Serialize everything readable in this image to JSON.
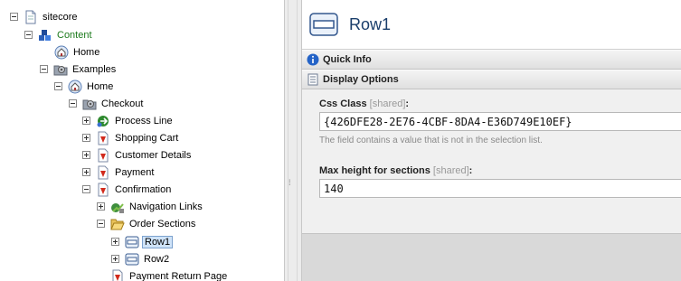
{
  "tree": {
    "items": [
      {
        "label": "sitecore",
        "toggle": "minus",
        "icon": "document-icon"
      },
      {
        "label": "Content",
        "toggle": "minus",
        "icon": "content-cubes-icon"
      },
      {
        "label": "Home",
        "toggle": "none",
        "icon": "home-icon"
      },
      {
        "label": "Examples",
        "toggle": "minus",
        "icon": "folder-gear-icon"
      },
      {
        "label": "Home",
        "toggle": "minus",
        "icon": "home-icon"
      },
      {
        "label": "Checkout",
        "toggle": "minus",
        "icon": "folder-gear-icon"
      },
      {
        "label": "Process Line",
        "toggle": "plus",
        "icon": "process-line-icon"
      },
      {
        "label": "Shopping Cart",
        "toggle": "plus",
        "icon": "page-red-icon"
      },
      {
        "label": "Customer Details",
        "toggle": "plus",
        "icon": "page-red-icon"
      },
      {
        "label": "Payment",
        "toggle": "plus",
        "icon": "page-red-icon"
      },
      {
        "label": "Confirmation",
        "toggle": "minus",
        "icon": "page-red-icon"
      },
      {
        "label": "Navigation Links",
        "toggle": "plus",
        "icon": "navigation-links-icon"
      },
      {
        "label": "Order Sections",
        "toggle": "minus",
        "icon": "folder-open-icon"
      },
      {
        "label": "Row1",
        "toggle": "plus",
        "icon": "row-icon"
      },
      {
        "label": "Row2",
        "toggle": "plus",
        "icon": "row-icon"
      },
      {
        "label": "Payment Return Page",
        "toggle": "none",
        "icon": "page-red-icon"
      }
    ]
  },
  "editor": {
    "title": "Row1",
    "sections": {
      "quick_info": "Quick Info",
      "display_options": "Display Options"
    },
    "fields": {
      "css_class": {
        "label": "Css Class",
        "shared": "[shared]",
        "colon": ":",
        "value": "{426DFE28-2E76-4CBF-8DA4-E36D749E10EF}",
        "note": "The field contains a value that is not in the selection list."
      },
      "max_height": {
        "label": "Max height for sections",
        "shared": "[shared]",
        "colon": ":",
        "value": "140"
      }
    }
  },
  "colors": {
    "title": "#1a3e6b",
    "content_label": "#1c7a1c",
    "selection": "#cfe3f8"
  }
}
